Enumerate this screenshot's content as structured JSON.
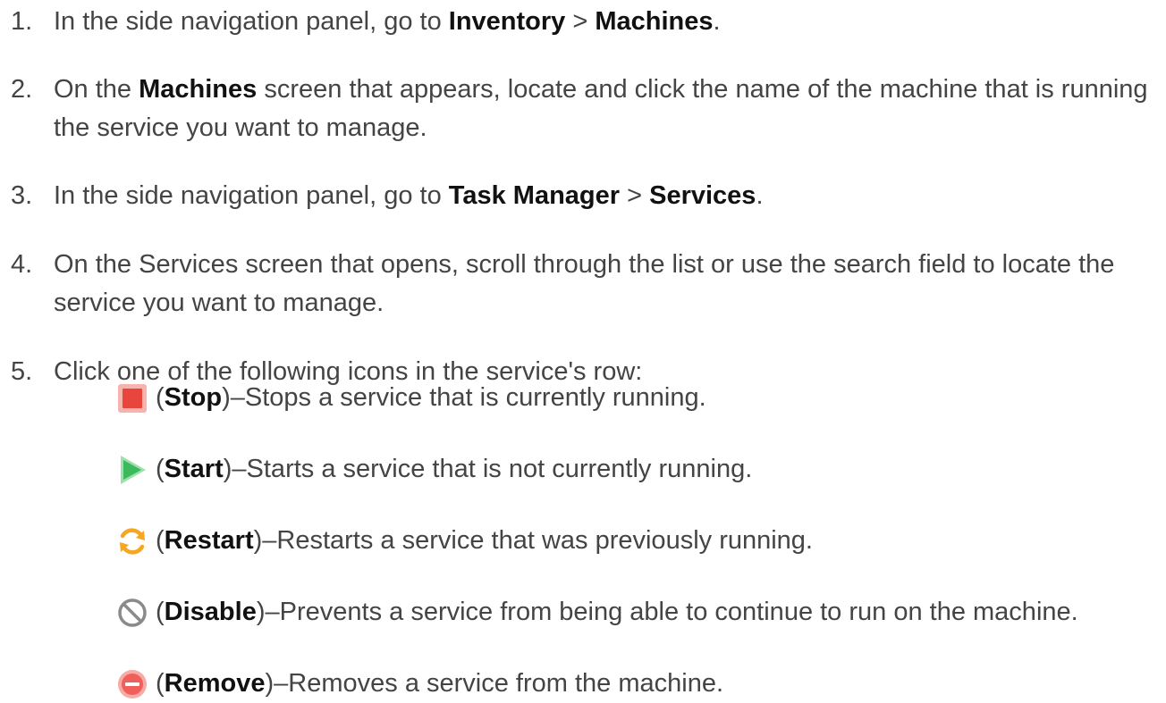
{
  "steps": [
    {
      "number": "1.",
      "pre": "In the side navigation panel, go to ",
      "b1": "Inventory",
      "mid": " > ",
      "b2": "Machines",
      "post": "."
    },
    {
      "number": "2.",
      "pre": "On the ",
      "b1": "Machines",
      "post": " screen that appears, locate and click the name of the machine that is running the service you want to manage."
    },
    {
      "number": "3.",
      "pre": "In the side navigation panel, go to ",
      "b1": "Task Manager",
      "mid": " > ",
      "b2": "Services",
      "post": "."
    },
    {
      "number": "4.",
      "text": "On the Services screen that opens, scroll through the list or use the search field to locate the service you want to manage."
    },
    {
      "number": "5.",
      "text": "Click one of the following icons in the service's row:"
    }
  ],
  "options": [
    {
      "icon": "stop-icon",
      "open": "(",
      "label": "Stop",
      "desc": ")–Stops a service that is currently running."
    },
    {
      "icon": "start-icon",
      "open": "(",
      "label": "Start",
      "desc": ")–Starts a service that is not currently running."
    },
    {
      "icon": "restart-icon",
      "open": "(",
      "label": "Restart",
      "desc": ")–Restarts a service that was previously running."
    },
    {
      "icon": "disable-icon",
      "open": "(",
      "label": "Disable",
      "desc": ")–Prevents a service from being able to continue to run on the machine."
    },
    {
      "icon": "remove-icon",
      "open": "(",
      "label": "Remove",
      "desc": ")–Removes a service from the machine."
    }
  ],
  "colors": {
    "text": "#444444",
    "bold_text": "#111111",
    "stop": "#e8453c",
    "start": "#3cb95a",
    "restart": "#f5a623",
    "disable": "#8a8a8a",
    "remove": "#f0605a"
  }
}
